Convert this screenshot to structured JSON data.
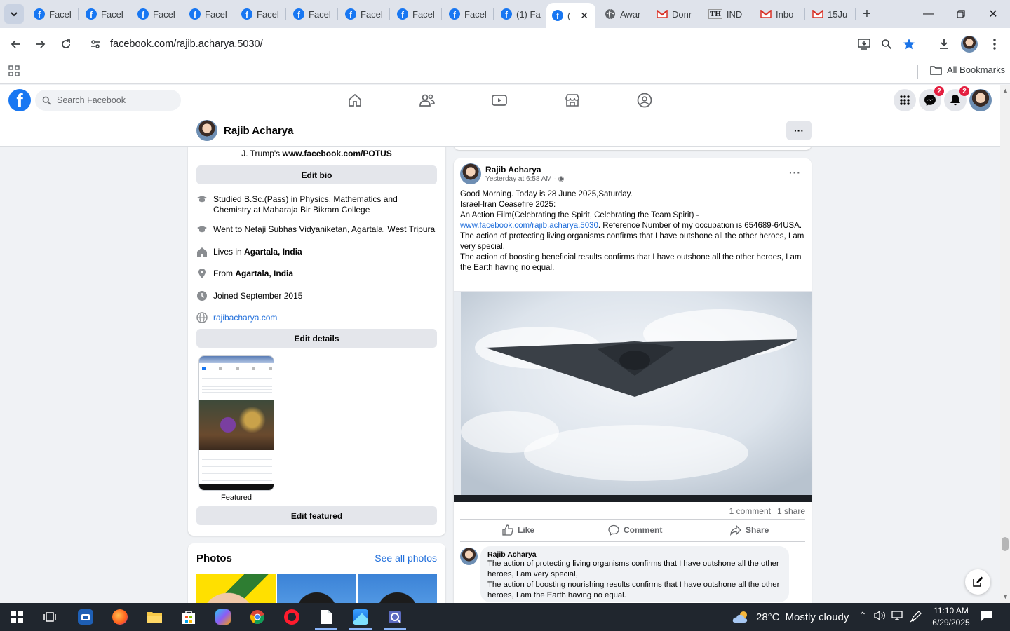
{
  "browser": {
    "tabs": [
      {
        "label": "Facel",
        "icon": "facebook-icon"
      },
      {
        "label": "Facel",
        "icon": "facebook-icon"
      },
      {
        "label": "Facel",
        "icon": "facebook-icon"
      },
      {
        "label": "Facel",
        "icon": "facebook-icon"
      },
      {
        "label": "Facel",
        "icon": "facebook-icon"
      },
      {
        "label": "Facel",
        "icon": "facebook-icon"
      },
      {
        "label": "Facel",
        "icon": "facebook-icon"
      },
      {
        "label": "Facel",
        "icon": "facebook-icon"
      },
      {
        "label": "Facel",
        "icon": "facebook-icon"
      },
      {
        "label": "(1) Fa",
        "icon": "facebook-icon"
      },
      {
        "label": "(",
        "icon": "facebook-icon",
        "active": true
      },
      {
        "label": "Awar",
        "icon": "globe-icon"
      },
      {
        "label": "Donr",
        "icon": "gmail-icon"
      },
      {
        "label": "IND",
        "icon": "site-icon"
      },
      {
        "label": "Inbo",
        "icon": "gmail-icon"
      },
      {
        "label": "15Ju",
        "icon": "gmail-icon"
      }
    ],
    "url": "facebook.com/rajib.acharya.5030/",
    "bookmarks_label": "All Bookmarks"
  },
  "facebook": {
    "search_placeholder": "Search Facebook",
    "messenger_badge": "2",
    "notifications_badge": "2",
    "profile_name": "Rajib Acharya"
  },
  "intro": {
    "bio_text_cut": "J. Trump's",
    "bio_link": "www.facebook.com/POTUS",
    "edit_bio": "Edit bio",
    "details": [
      {
        "icon": "graduation-cap-icon",
        "text": "Studied B.Sc.(Pass) in Physics, Mathematics and Chemistry at Maharaja Bir Bikram College"
      },
      {
        "icon": "school-icon",
        "text": "Went to Netaji Subhas Vidyaniketan, Agartala, West Tripura"
      },
      {
        "icon": "home-icon",
        "prefix": "Lives in ",
        "bold": "Agartala, India"
      },
      {
        "icon": "location-pin-icon",
        "prefix": "From ",
        "bold": "Agartala, India"
      },
      {
        "icon": "clock-icon",
        "text": "Joined September 2015"
      },
      {
        "icon": "globe-icon",
        "link": "rajibacharya.com"
      }
    ],
    "edit_details": "Edit details",
    "featured_label": "Featured",
    "edit_featured": "Edit featured"
  },
  "photos": {
    "title": "Photos",
    "see_all": "See all photos"
  },
  "post": {
    "author": "Rajib Acharya",
    "time": "Yesterday at 6:58 AM",
    "lines": [
      "Good Morning. Today is 28 June 2025,Saturday.",
      "Israel-Iran Ceasefire 2025:",
      "An Action Film(Celebrating the Spirit, Celebrating the Team Spirit) -"
    ],
    "link": "www.facebook.com/rajib.acharya.5030",
    "link_after": ". Reference Number of my occupation is 654689-64USA.",
    "line_protect": "The action of protecting living organisms confirms that I have outshone all the other heroes, I am very special,",
    "line_boost": " The action of boosting beneficial results confirms that I have outshone all the other heroes, I am the Earth having no equal.",
    "comments_count": "1 comment",
    "shares_count": "1 share",
    "like": "Like",
    "comment": "Comment",
    "share": "Share"
  },
  "comment": {
    "author": "Rajib Acharya",
    "line1": "The action of protecting living organisms confirms that I have outshone all the other heroes, I am very special,",
    "line2": "The action of boosting nourishing results confirms that I have outshone all the other heroes, I am the Earth having no equal."
  },
  "taskbar": {
    "weather_temp": "28°C",
    "weather_text": "Mostly cloudy",
    "time": "11:10 AM",
    "date": "6/29/2025"
  },
  "colors": {
    "facebook_blue": "#1877f2",
    "link_blue": "#216fdb",
    "badge_red": "#e41e3f",
    "taskbar_bg": "#20262e"
  }
}
